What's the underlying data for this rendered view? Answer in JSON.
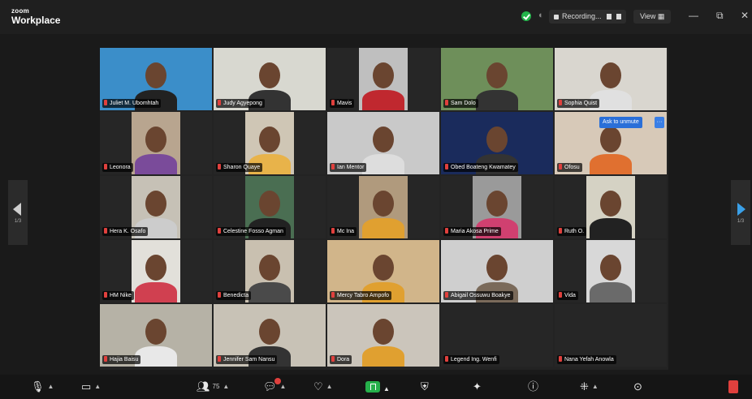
{
  "app": {
    "brand_small": "zoom",
    "brand_main": "Workplace",
    "recording_label": "Recording...",
    "view_label": "View",
    "minimize": "—",
    "restore": "⧉",
    "close": "✕"
  },
  "nav": {
    "left_page": "1/3",
    "right_page": "1/3"
  },
  "actions": {
    "add_to_webinar": "Ask to unmute",
    "add_more": "···"
  },
  "participants": [
    {
      "name": "Juliet M. Ubomhtah"
    },
    {
      "name": "Judy Agyepong"
    },
    {
      "name": "Mavis"
    },
    {
      "name": "Sam Dolo"
    },
    {
      "name": "Sophia Quist"
    },
    {
      "name": "Leonora"
    },
    {
      "name": "Sharon Quaye"
    },
    {
      "name": "Ian Mentor"
    },
    {
      "name": "Obed Boateng Kwamatey"
    },
    {
      "name": "Ofosu"
    },
    {
      "name": "Hera K. Osafo"
    },
    {
      "name": "Celestine Fosso Agman"
    },
    {
      "name": "Mc Ina"
    },
    {
      "name": "Maria Akosa Prime"
    },
    {
      "name": "Ruth O."
    },
    {
      "name": "HM Nike"
    },
    {
      "name": "Benedicta"
    },
    {
      "name": "Mercy Tabro Ampofo"
    },
    {
      "name": "Abigail Ossuwu Boakye"
    },
    {
      "name": "Vida"
    },
    {
      "name": "Hajia Baisu"
    },
    {
      "name": "Jennifer Sam Nansu"
    },
    {
      "name": "Dora"
    },
    {
      "name": "Legend Ing. Wenfi"
    },
    {
      "name": "Nana Yefah Anowla"
    }
  ],
  "toolbar": {
    "participants_count": "75"
  },
  "colors": {
    "active_speaker": "#2fb34a",
    "mic_muted": "#e0403d",
    "share_green": "#26b04b",
    "accent_blue": "#2a6fd8"
  }
}
